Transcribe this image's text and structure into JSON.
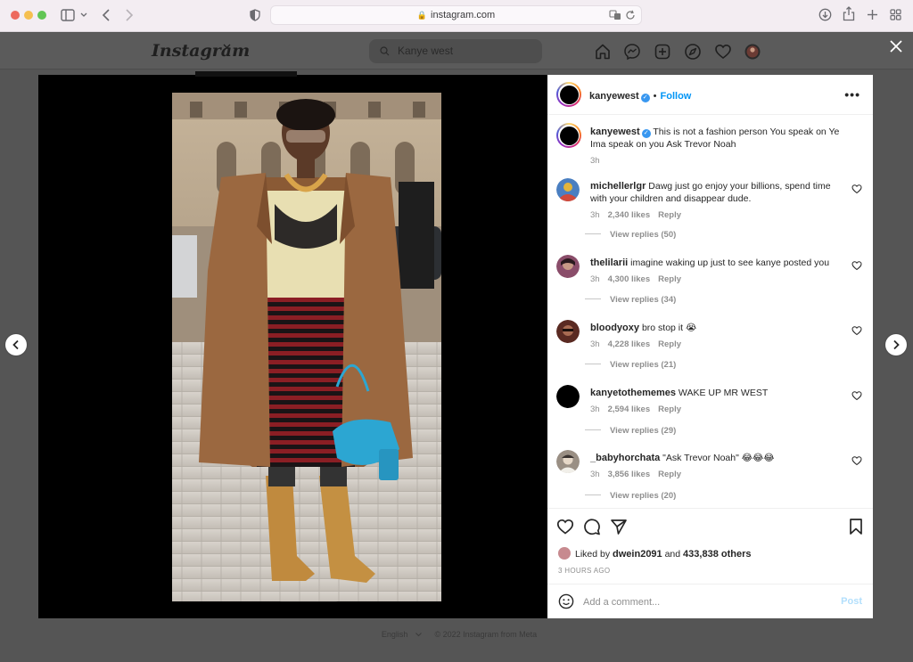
{
  "browser": {
    "url": "instagram.com",
    "lock_glyph": "🔒"
  },
  "header": {
    "logo": "Instagram",
    "search_value": "Kanye west"
  },
  "post": {
    "username": "kanyewest",
    "follow_label": "Follow",
    "dot": "•",
    "caption": "This is not a fashion person You speak on Ye Ima speak on you Ask Trevor Noah",
    "caption_time": "3h"
  },
  "comments": [
    {
      "user": "michellerlgr",
      "text": "Dawg just go enjoy your billions, spend time with your children and disappear dude.",
      "time": "3h",
      "likes": "2,340 likes",
      "reply": "Reply",
      "view_replies": "View replies (50)",
      "avatar_color": "#4a7fc1"
    },
    {
      "user": "thelilarii",
      "text": "imagine waking up just to see kanye posted you",
      "time": "3h",
      "likes": "4,300 likes",
      "reply": "Reply",
      "view_replies": "View replies (34)",
      "avatar_color": "#8a4d6a"
    },
    {
      "user": "bloodyoxy",
      "text": "bro stop it 😭",
      "time": "3h",
      "likes": "4,228 likes",
      "reply": "Reply",
      "view_replies": "View replies (21)",
      "avatar_color": "#5a2a22"
    },
    {
      "user": "kanyetothememes",
      "text": "WAKE UP MR WEST",
      "time": "3h",
      "likes": "2,594 likes",
      "reply": "Reply",
      "view_replies": "View replies (29)",
      "avatar_color": "#000000"
    },
    {
      "user": "_babyhorchata",
      "text": "\"Ask Trevor Noah\" 😂😂😂",
      "time": "3h",
      "likes": "3,856 likes",
      "reply": "Reply",
      "view_replies": "View replies (20)",
      "avatar_color": "#9a8f84"
    }
  ],
  "likes": {
    "prefix": "Liked by",
    "user": "dwein2091",
    "joiner": "and",
    "others": "433,838 others"
  },
  "posted_ago": "3 HOURS AGO",
  "add_comment": {
    "placeholder": "Add a comment...",
    "post_label": "Post"
  },
  "footer": {
    "language": "English",
    "copyright": "© 2022 Instagram from Meta"
  }
}
